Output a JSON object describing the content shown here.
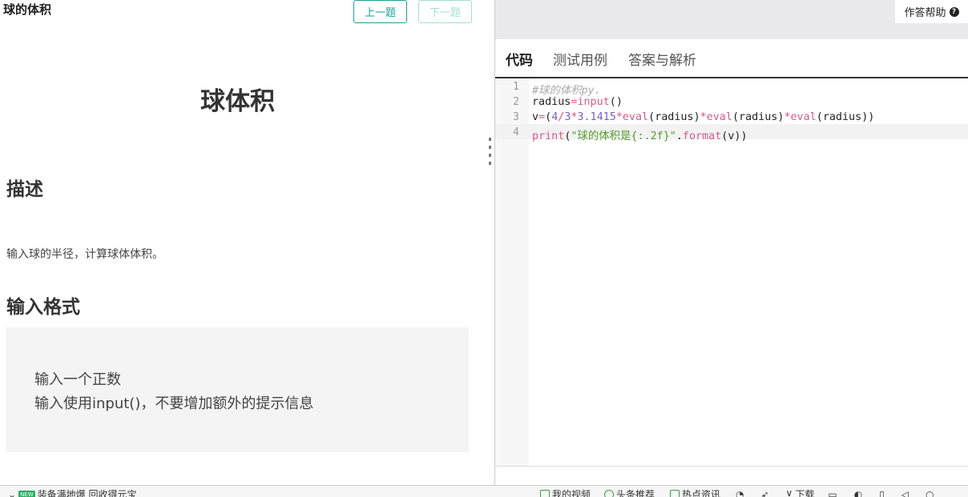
{
  "problem": {
    "name": "球的体积",
    "prev_label": "上一题",
    "next_label": "下一题",
    "title": "球体积",
    "description_heading": "描述",
    "description_text": "输入球的半径，计算球体体积。",
    "format_heading": "输入格式",
    "format_lines": [
      "输入一个正数",
      "输入使用input()，不要增加额外的提示信息"
    ]
  },
  "editor_panel": {
    "help_label": "作答帮助",
    "help_icon": "question-circle-icon",
    "tabs": [
      {
        "label": "代码",
        "active": true
      },
      {
        "label": "测试用例",
        "active": false
      },
      {
        "label": "答案与解析",
        "active": false
      }
    ],
    "line_numbers": [
      "1",
      "2",
      "3",
      "4"
    ],
    "code_lines": [
      "#球的体积py.",
      "radius=input()",
      "v=(4/3*3.1415*eval(radius)*eval(radius)*eval(radius))",
      "print(\"球的体积是{:.2f}\".format(v))"
    ]
  },
  "statusbar": {
    "left_badge": "NEW",
    "left_text": "装备满地爆 回收得元宝",
    "items": [
      "我的视频",
      "头条推荐",
      "热点资讯",
      "下载"
    ]
  },
  "colors": {
    "accent": "#1aa391",
    "keyword": "#d55b8c",
    "string": "#5a9c2f",
    "number": "#7a5fc0",
    "comment": "#aaaaaa"
  }
}
